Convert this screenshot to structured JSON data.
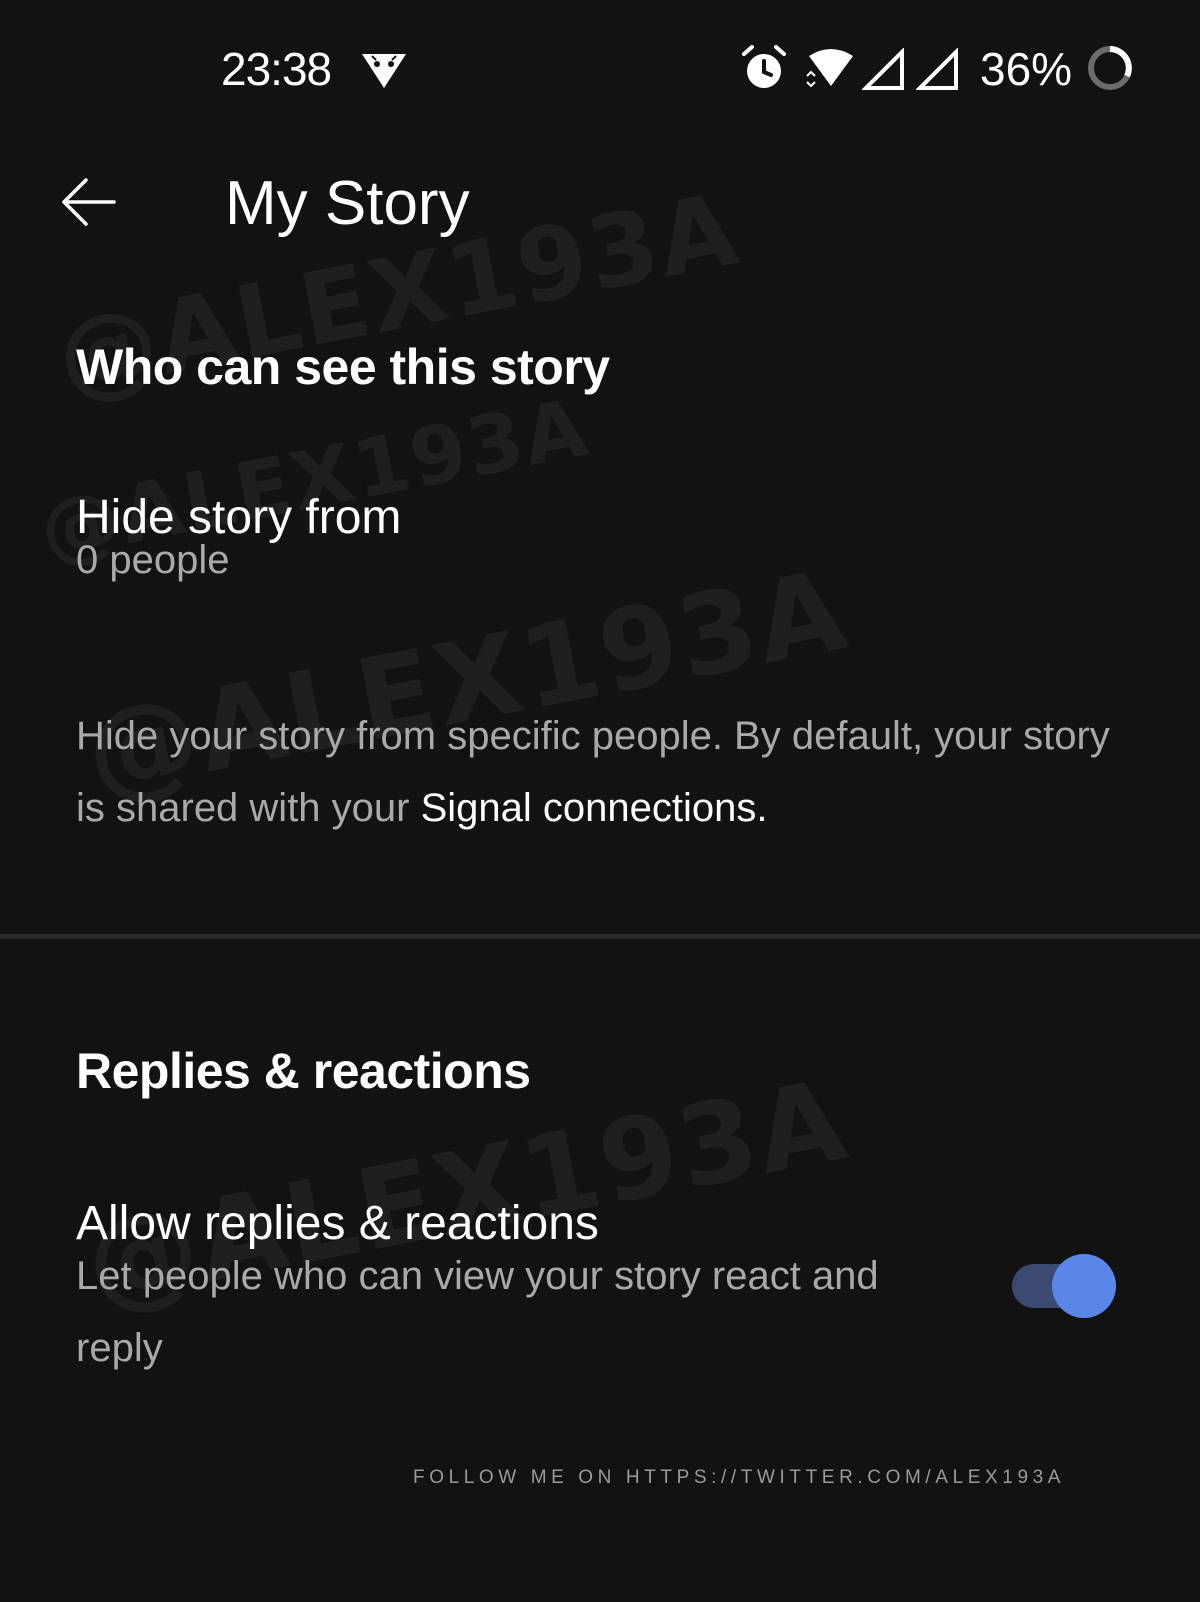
{
  "status_bar": {
    "time": "23:38",
    "battery": "36%",
    "icons": [
      "android-icon",
      "alarm-icon",
      "wifi-icon",
      "signal-icon",
      "signal-icon",
      "battery-ring-icon"
    ]
  },
  "toolbar": {
    "back_icon": "arrow-left-icon",
    "title": "My Story"
  },
  "sections": {
    "visibility": {
      "header": "Who can see this story",
      "hide_story": {
        "title": "Hide story from",
        "summary": "0 people"
      },
      "description": {
        "text": "Hide your story from specific people. By default, your story is shared with your ",
        "link": "Signal connections."
      }
    },
    "replies": {
      "header": "Replies & reactions",
      "allow": {
        "title": "Allow replies & reactions",
        "summary": "Let people who can view your story react and reply",
        "enabled": true
      }
    }
  },
  "watermark": "@ALEX193A",
  "footer": "FOLLOW ME ON HTTPS://TWITTER.COM/ALEX193A",
  "colors": {
    "background": "#121212",
    "primary_text": "#ffffff",
    "secondary_text": "#a9a9a9",
    "toggle_thumb": "#5a86e8",
    "toggle_track": "#3a4a70",
    "divider": "#2a2a2a"
  }
}
